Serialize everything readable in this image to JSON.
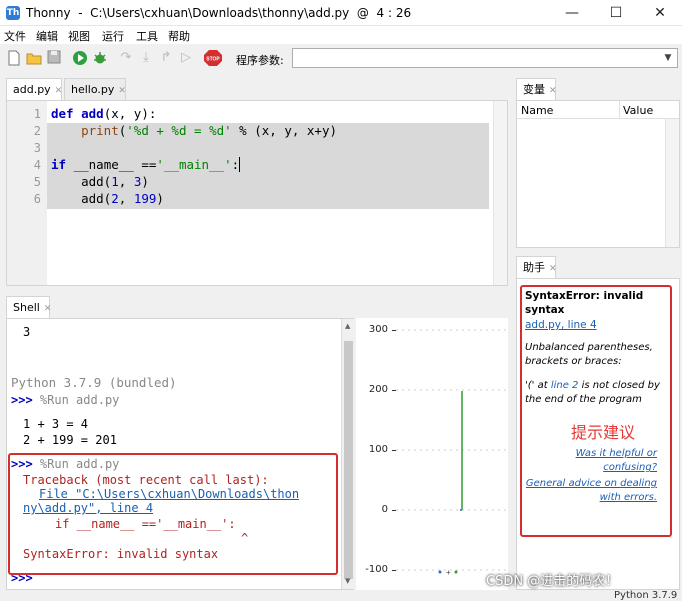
{
  "window": {
    "title": "Thonny  -  C:\\Users\\cxhuan\\Downloads\\thonny\\add.py  @  4 : 26",
    "min_glyph": "—",
    "max_glyph": "☐",
    "close_glyph": "✕"
  },
  "menu": [
    "文件",
    "编辑",
    "视图",
    "运行",
    "工具",
    "帮助"
  ],
  "toolbar": {
    "args_label": "程序参数:",
    "args_value": "",
    "stop_label": "STOP"
  },
  "editor": {
    "tabs": [
      {
        "label": "add.py"
      },
      {
        "label": "hello.py"
      }
    ],
    "lines": [
      "1",
      "2",
      "3",
      "4",
      "5",
      "6"
    ]
  },
  "variables": {
    "tab": "变量",
    "col_name": "Name",
    "col_value": "Value"
  },
  "help": {
    "tab": "助手",
    "error_title": "SyntaxError: invalid syntax",
    "location_link": "add.py, line 4",
    "explain": "Unbalanced parentheses, brackets or braces:",
    "detail_pre": "'(' at ",
    "detail_link": "line 2",
    "detail_post": " is not closed by the end of the program",
    "annotation": "提示建议",
    "feedback_link": "Was it helpful or confusing?",
    "general_link": "General advice on dealing with errors."
  },
  "shell": {
    "tab": "Shell",
    "out_3": "3",
    "version": "Python 3.7.9 (bundled)",
    "prompt": ">>>",
    "run1": "%Run add.py",
    "res1": "1 + 3 = 4",
    "res2": "2 + 199 = 201",
    "run2": "%Run add.py",
    "tb_head": "Traceback (most recent call last):",
    "tb_file1": "File \"C:\\Users\\cxhuan\\Downloads\\thon",
    "tb_file2": "ny\\add.py\", line 4",
    "tb_code": "if __name__ =='__main__':",
    "tb_caret": "^",
    "tb_error": "SyntaxError: invalid syntax"
  },
  "plot": {
    "yticks": [
      "300",
      "200",
      "100",
      "0",
      "-100"
    ]
  },
  "status": {
    "interpreter": "Python 3.7.9"
  },
  "watermark": "CSDN @进击的码农！",
  "colors": {
    "error_box": "#d32f2f",
    "annotation": "#e53935",
    "plot_line": "#2e9e2e"
  }
}
